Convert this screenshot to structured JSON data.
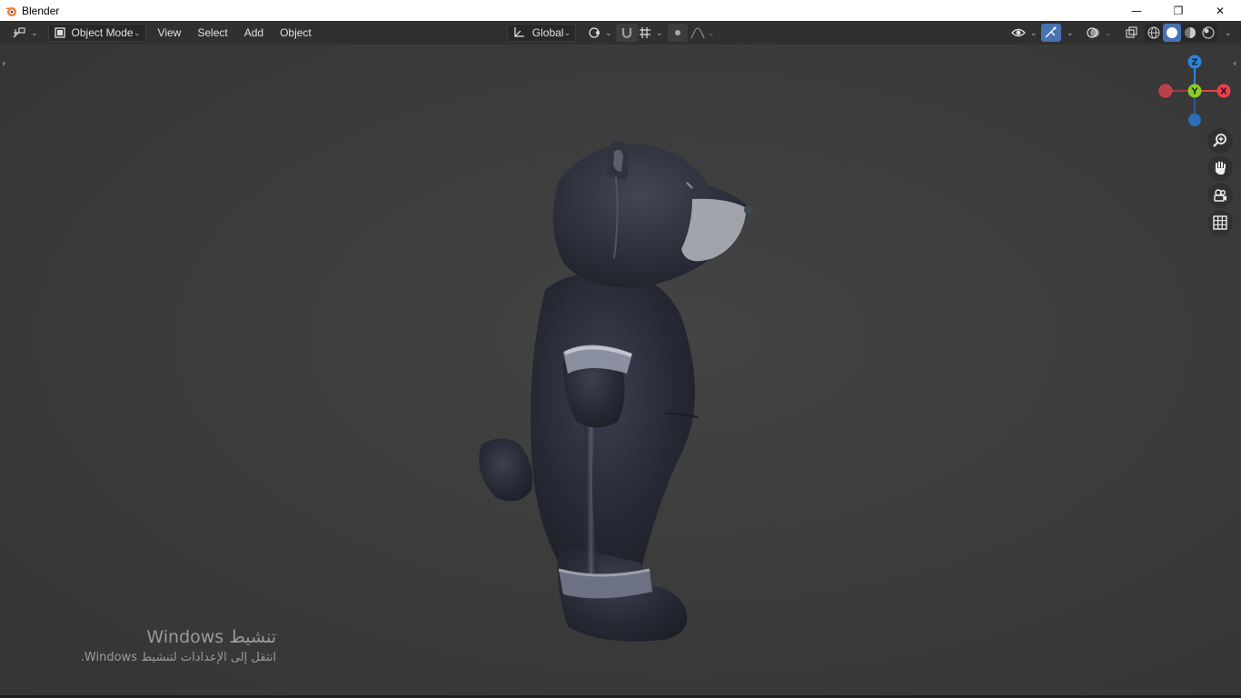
{
  "window": {
    "title": "Blender",
    "logo_icon": "blender-logo-icon",
    "controls": {
      "minimize": "—",
      "maximize": "❐",
      "close": "✕"
    }
  },
  "header": {
    "editor_type_icon": "editor-type-icon",
    "mode": "Object Mode",
    "menus": [
      "View",
      "Select",
      "Add",
      "Object"
    ],
    "transform_orientation": "Global"
  },
  "gizmo": {
    "axes": {
      "x": "X",
      "y": "Y",
      "z": "Z"
    },
    "colors": {
      "x": "#e8424f",
      "y": "#8bcb29",
      "z": "#2f83d8"
    }
  },
  "activation": {
    "title": "تنشيط Windows",
    "subtitle": "انتقل إلى الإعدادات لتنشيط Windows."
  },
  "colors": {
    "accent": "#4772b3",
    "header_bg": "#303030",
    "viewport_bg": "#3d3d3d"
  }
}
